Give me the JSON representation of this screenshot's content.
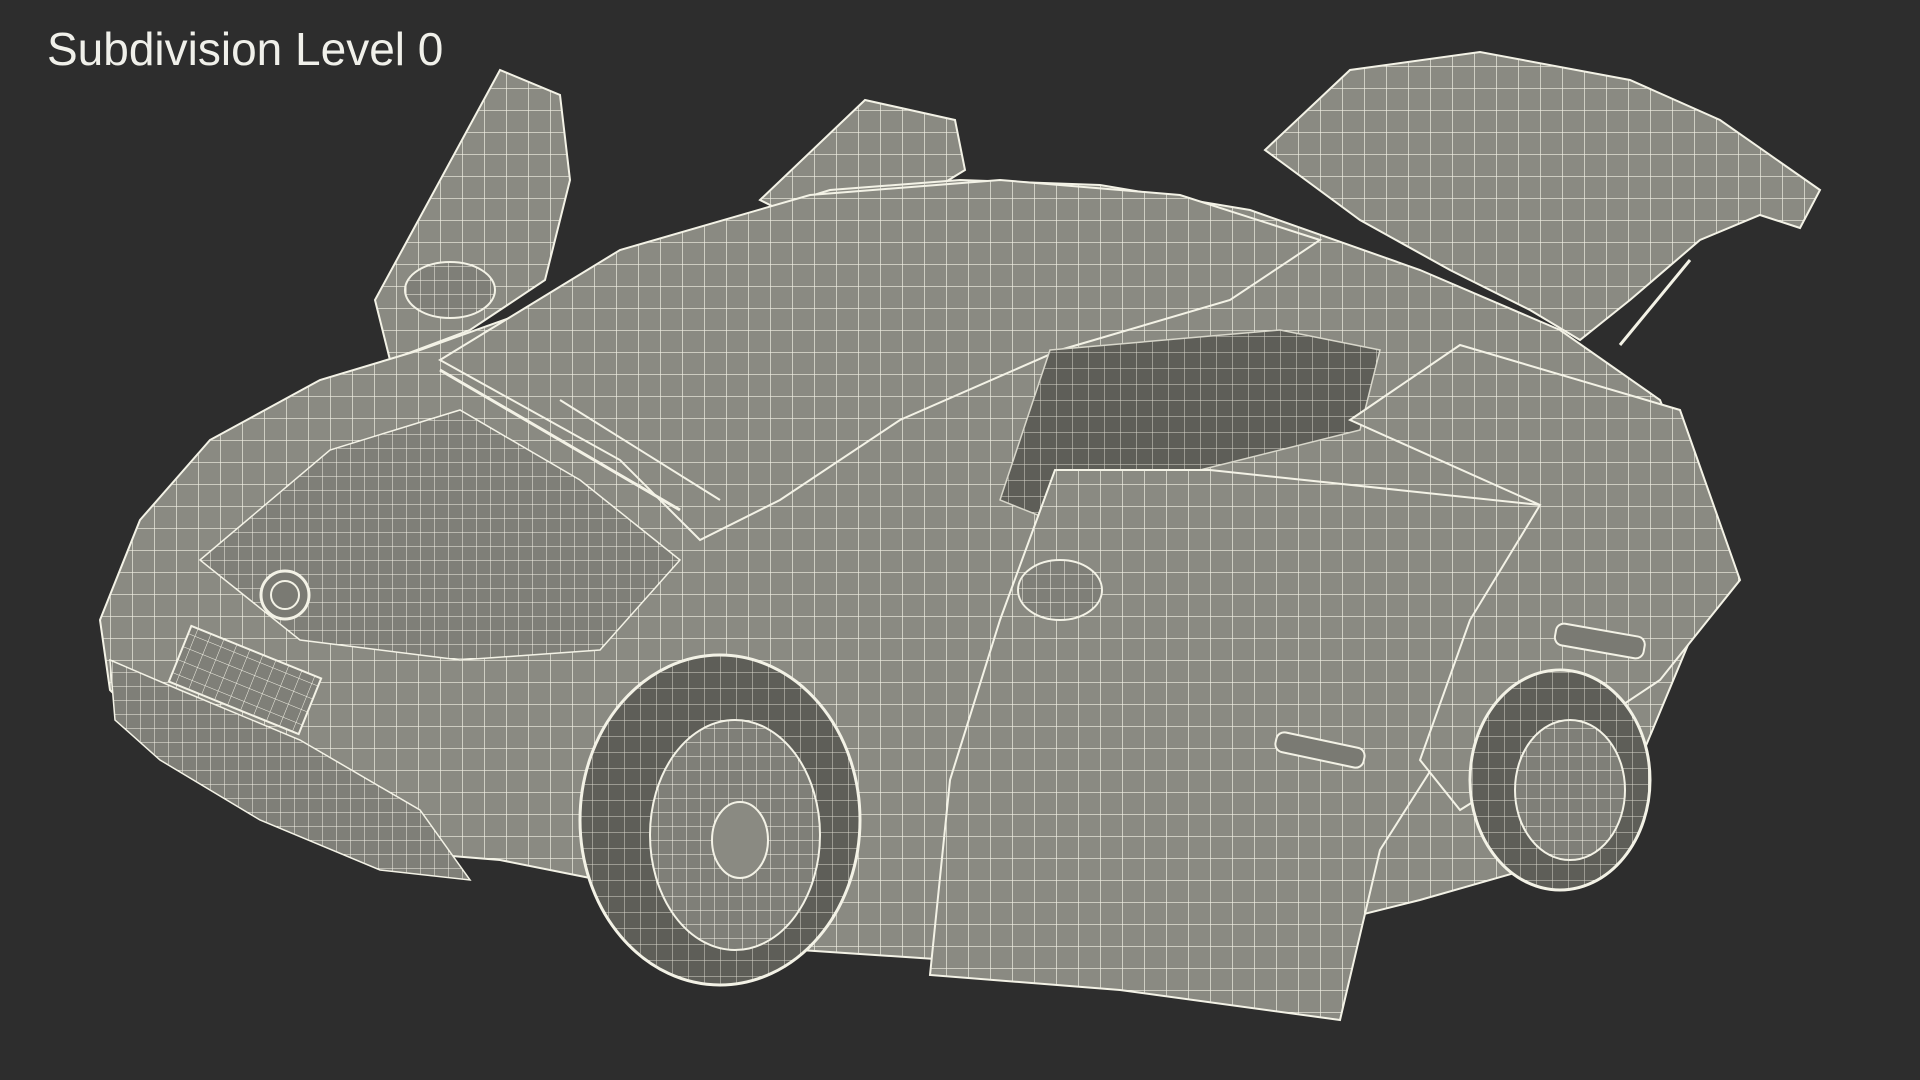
{
  "viewport": {
    "label": "Subdivision Level 0",
    "background": "#2d2d2d",
    "mesh_fill": "#8a8a82",
    "wire_color": "#f3f2e6"
  }
}
